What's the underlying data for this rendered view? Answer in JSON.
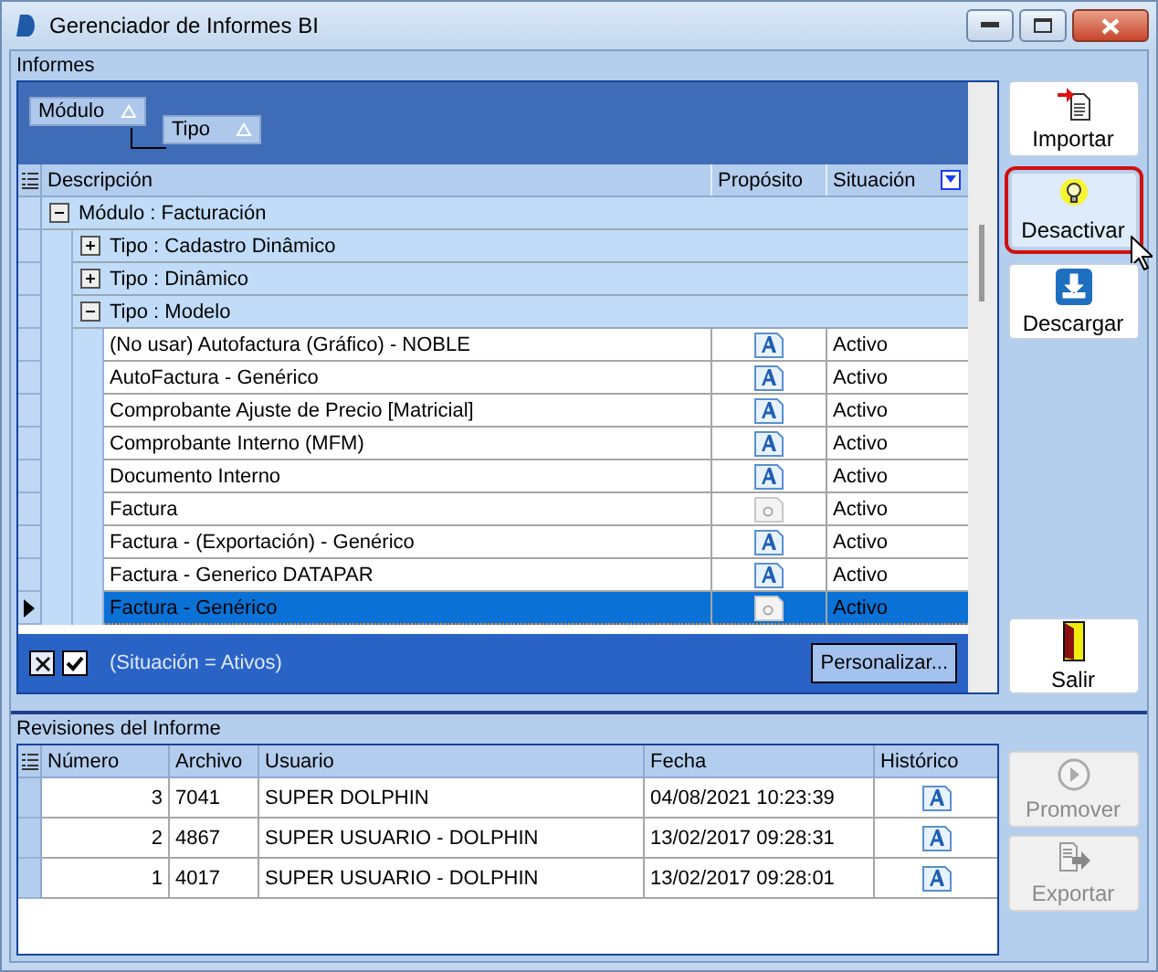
{
  "window": {
    "title": "Gerenciador de Informes BI"
  },
  "informes": {
    "label": "Informes",
    "group_by": [
      {
        "label": "Módulo"
      },
      {
        "label": "Tipo"
      }
    ],
    "columns": [
      "Descripción",
      "Propósito",
      "Situación"
    ],
    "tree": [
      {
        "label": "Módulo : Facturación",
        "expanded": true,
        "children": [
          {
            "label": "Tipo : Cadastro Dinâmico",
            "expanded": false
          },
          {
            "label": "Tipo : Dinâmico",
            "expanded": false
          },
          {
            "label": "Tipo : Modelo",
            "expanded": true,
            "children": [
              {
                "description": "(No usar) Autofactura (Gráfico) - NOBLE",
                "purpose_enabled": true,
                "status": "Activo",
                "selected": false
              },
              {
                "description": "AutoFactura - Genérico",
                "purpose_enabled": true,
                "status": "Activo",
                "selected": false
              },
              {
                "description": "Comprobante Ajuste de Precio [Matricial]",
                "purpose_enabled": true,
                "status": "Activo",
                "selected": false
              },
              {
                "description": "Comprobante Interno (MFM)",
                "purpose_enabled": true,
                "status": "Activo",
                "selected": false
              },
              {
                "description": "Documento Interno",
                "purpose_enabled": true,
                "status": "Activo",
                "selected": false
              },
              {
                "description": "Factura",
                "purpose_enabled": false,
                "status": "Activo",
                "selected": false
              },
              {
                "description": "Factura - (Exportación) - Genérico",
                "purpose_enabled": true,
                "status": "Activo",
                "selected": false
              },
              {
                "description": "Factura - Generico DATAPAR",
                "purpose_enabled": true,
                "status": "Activo",
                "selected": false
              },
              {
                "description": "Factura - Genérico",
                "purpose_enabled": false,
                "status": "Activo",
                "selected": true
              }
            ]
          }
        ]
      }
    ],
    "filter": {
      "checked": true,
      "text": "(Situación = Ativos)",
      "button": "Personalizar..."
    }
  },
  "side_buttons": [
    {
      "kind": "import",
      "label": "Importar",
      "highlighted": false
    },
    {
      "kind": "bulb",
      "label": "Desactivar",
      "highlighted": true
    },
    {
      "kind": "download",
      "label": "Descargar",
      "highlighted": false
    },
    {
      "kind": "exit",
      "label": "Salir",
      "highlighted": false
    }
  ],
  "revisiones": {
    "label": "Revisiones del Informe",
    "columns": [
      "Número",
      "Archivo",
      "Usuario",
      "Fecha",
      "Histórico"
    ],
    "rows": [
      {
        "numero": "3",
        "archivo": "7041",
        "usuario": "SUPER DOLPHIN",
        "fecha": "04/08/2021 10:23:39"
      },
      {
        "numero": "2",
        "archivo": "4867",
        "usuario": "SUPER USUARIO - DOLPHIN",
        "fecha": "13/02/2017 09:28:31"
      },
      {
        "numero": "1",
        "archivo": "4017",
        "usuario": "SUPER USUARIO - DOLPHIN",
        "fecha": "13/02/2017 09:28:01"
      }
    ]
  },
  "revision_buttons": [
    {
      "kind": "play",
      "label": "Promover",
      "disabled": true
    },
    {
      "kind": "export",
      "label": "Exportar",
      "disabled": true
    }
  ]
}
